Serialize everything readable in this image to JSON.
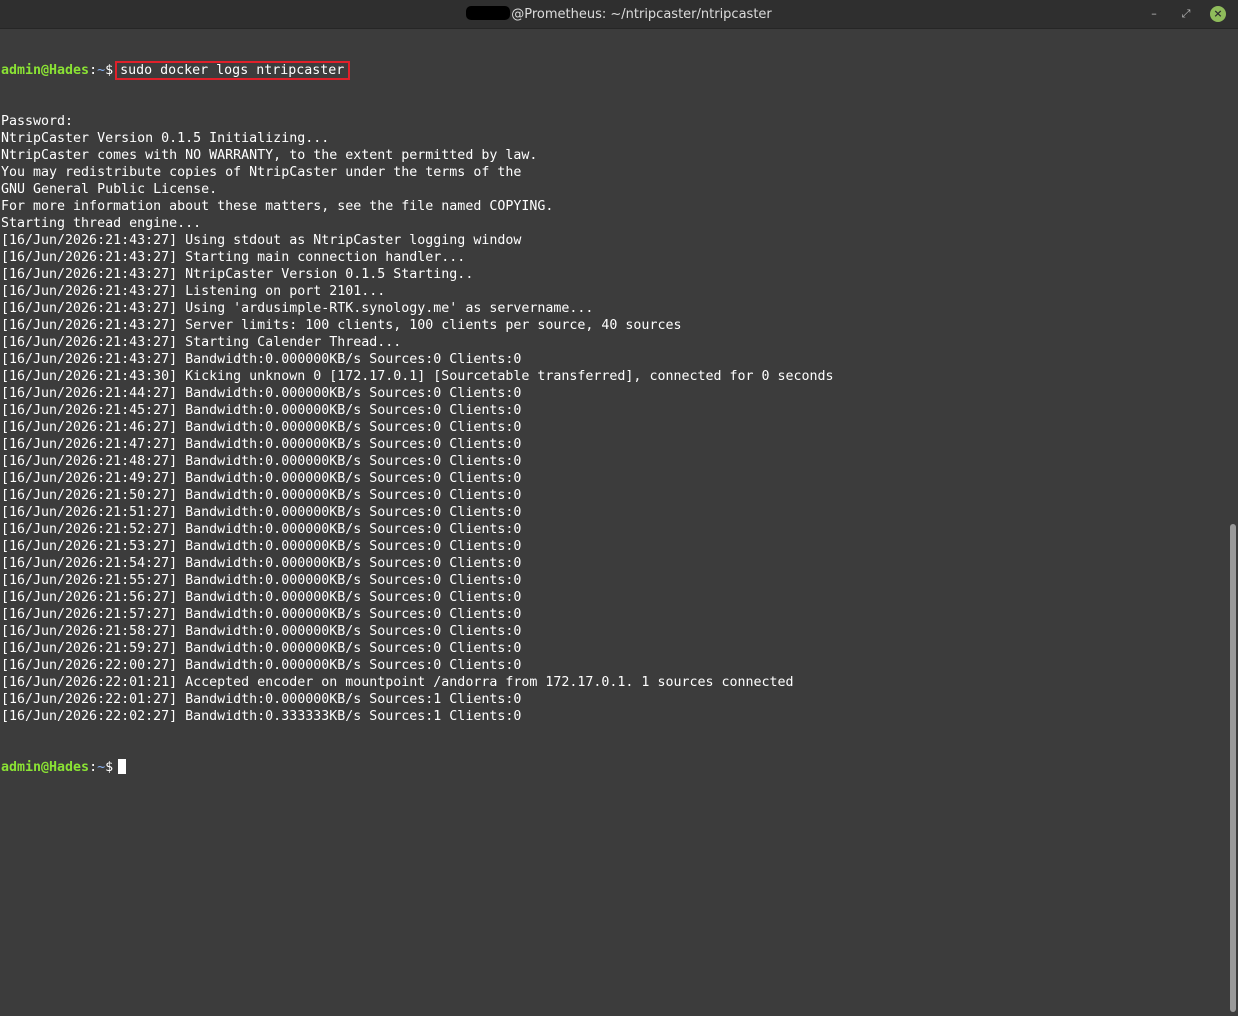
{
  "window": {
    "title_suffix": "@Prometheus: ~/ntripcaster/ntripcaster",
    "minimize_glyph": "–",
    "maximize_glyph": "⤢",
    "close_glyph": "×",
    "close_color": "#8fbc5b"
  },
  "terminal": {
    "prompt": {
      "user_host": "admin@Hades",
      "separator": ":",
      "path": "~",
      "symbol": "$"
    },
    "command": "sudo docker logs ntripcaster",
    "highlight_color": "#e0202a",
    "output": [
      "Password:",
      "NtripCaster Version 0.1.5 Initializing...",
      "NtripCaster comes with NO WARRANTY, to the extent permitted by law.",
      "You may redistribute copies of NtripCaster under the terms of the",
      "GNU General Public License.",
      "For more information about these matters, see the file named COPYING.",
      "Starting thread engine...",
      "[16/Jun/2026:21:43:27] Using stdout as NtripCaster logging window",
      "[16/Jun/2026:21:43:27] Starting main connection handler...",
      "[16/Jun/2026:21:43:27] NtripCaster Version 0.1.5 Starting..",
      "[16/Jun/2026:21:43:27] Listening on port 2101...",
      "[16/Jun/2026:21:43:27] Using 'ardusimple-RTK.synology.me' as servername...",
      "[16/Jun/2026:21:43:27] Server limits: 100 clients, 100 clients per source, 40 sources",
      "[16/Jun/2026:21:43:27] Starting Calender Thread...",
      "[16/Jun/2026:21:43:27] Bandwidth:0.000000KB/s Sources:0 Clients:0",
      "[16/Jun/2026:21:43:30] Kicking unknown 0 [172.17.0.1] [Sourcetable transferred], connected for 0 seconds",
      "[16/Jun/2026:21:44:27] Bandwidth:0.000000KB/s Sources:0 Clients:0",
      "[16/Jun/2026:21:45:27] Bandwidth:0.000000KB/s Sources:0 Clients:0",
      "[16/Jun/2026:21:46:27] Bandwidth:0.000000KB/s Sources:0 Clients:0",
      "[16/Jun/2026:21:47:27] Bandwidth:0.000000KB/s Sources:0 Clients:0",
      "[16/Jun/2026:21:48:27] Bandwidth:0.000000KB/s Sources:0 Clients:0",
      "[16/Jun/2026:21:49:27] Bandwidth:0.000000KB/s Sources:0 Clients:0",
      "[16/Jun/2026:21:50:27] Bandwidth:0.000000KB/s Sources:0 Clients:0",
      "[16/Jun/2026:21:51:27] Bandwidth:0.000000KB/s Sources:0 Clients:0",
      "[16/Jun/2026:21:52:27] Bandwidth:0.000000KB/s Sources:0 Clients:0",
      "[16/Jun/2026:21:53:27] Bandwidth:0.000000KB/s Sources:0 Clients:0",
      "[16/Jun/2026:21:54:27] Bandwidth:0.000000KB/s Sources:0 Clients:0",
      "[16/Jun/2026:21:55:27] Bandwidth:0.000000KB/s Sources:0 Clients:0",
      "[16/Jun/2026:21:56:27] Bandwidth:0.000000KB/s Sources:0 Clients:0",
      "[16/Jun/2026:21:57:27] Bandwidth:0.000000KB/s Sources:0 Clients:0",
      "[16/Jun/2026:21:58:27] Bandwidth:0.000000KB/s Sources:0 Clients:0",
      "[16/Jun/2026:21:59:27] Bandwidth:0.000000KB/s Sources:0 Clients:0",
      "[16/Jun/2026:22:00:27] Bandwidth:0.000000KB/s Sources:0 Clients:0",
      "[16/Jun/2026:22:01:21] Accepted encoder on mountpoint /andorra from 172.17.0.1. 1 sources connected",
      "[16/Jun/2026:22:01:27] Bandwidth:0.000000KB/s Sources:1 Clients:0",
      "[16/Jun/2026:22:02:27] Bandwidth:0.333333KB/s Sources:1 Clients:0"
    ]
  }
}
